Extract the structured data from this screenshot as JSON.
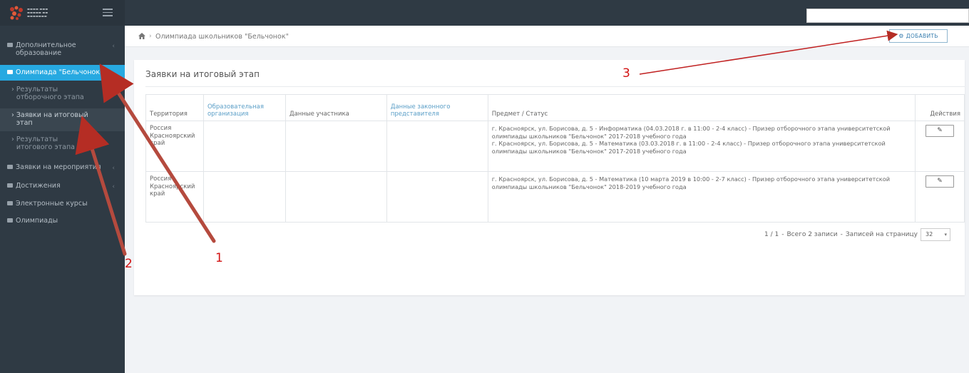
{
  "sidebar": {
    "items": [
      {
        "label": "Дополнительное образование"
      },
      {
        "label": "Олимпиада \"Бельчонок\""
      },
      {
        "label": "Заявки на мероприятия"
      },
      {
        "label": "Достижения"
      },
      {
        "label": "Электронные курсы"
      },
      {
        "label": "Олимпиады"
      }
    ],
    "subitems": [
      {
        "label": "Результаты отборочного этапа"
      },
      {
        "label": "Заявки на итоговый этап"
      },
      {
        "label": "Результаты итогового этапа"
      }
    ]
  },
  "breadcrumb": {
    "current": "Олимпиада школьников \"Бельчонок\""
  },
  "toolbar": {
    "add_label": "ДОБАВИТЬ"
  },
  "panel": {
    "title": "Заявки на итоговый этап"
  },
  "table": {
    "headers": [
      "Территория",
      "Образовательная организация",
      "Данные участника",
      "Данные законного представителя",
      "Предмет / Статус",
      "Действия"
    ],
    "rows": [
      {
        "territory": "Россия Красноярский край",
        "org": "",
        "participant": "",
        "representative": "",
        "subject_1": "г. Красноярск, ул. Борисова, д. 5 - Информатика (04.03.2018 г. в 11:00 - 2-4 класс) - Призер отборочного этапа университетской олимпиады школьников \"Бельчонок\" 2017-2018 учебного года",
        "subject_2": "г. Красноярск, ул. Борисова, д. 5 - Математика (03.03.2018 г. в 11:00 - 2-4 класс) - Призер отборочного этапа университетской олимпиады школьников \"Бельчонок\" 2017-2018 учебного года"
      },
      {
        "territory": "Россия Красноярский край",
        "org": "",
        "participant": "",
        "representative": "",
        "subject_1": "г. Красноярск, ул. Борисова, д. 5 - Математика (10 марта 2019 в 10:00 - 2-7 класс) - Призер отборочного этапа университетской олимпиады школьников \"Бельчонок\" 2018-2019 учебного года",
        "subject_2": ""
      }
    ]
  },
  "pager": {
    "pages": "1 / 1",
    "sep": "-",
    "total": "Всего 2 записи",
    "per_page_label": "Записей на страницу",
    "per_page_value": "32"
  },
  "annotations": {
    "one": "1",
    "two": "2",
    "three": "3"
  },
  "colors": {
    "sidebar": "#2f3a44",
    "active": "#27a9e1",
    "annotation": "#d21212"
  }
}
